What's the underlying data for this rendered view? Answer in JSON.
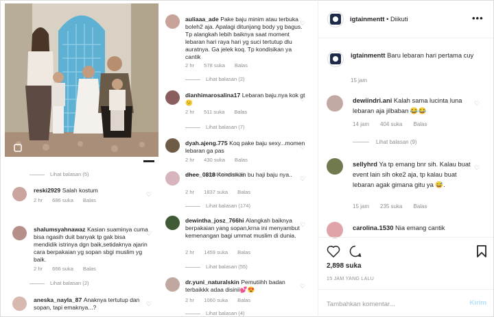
{
  "left": {
    "comments_mid": [
      {
        "user": "auliaaa_ade",
        "text": "Pake baju minim atau terbuka boleh2 aja. Apalagi ditunjang body yg bagus. Tp alangkah lebih baiknya saat moment lebaran hari raya hari yg suci tertutup dlu auratnya. Ga jelek koq. Tp kondisikan ya cantik",
        "time": "2 hr",
        "likes": "578 suka",
        "reply": "Balas",
        "replies": "Lihat balasan (2)"
      },
      {
        "user": "dianhimarosalina17",
        "text": "Lebaran baju.nya kok gt 😕",
        "time": "2 hr",
        "likes": "511 suka",
        "reply": "Balas",
        "replies": "Lihat balasan (7)"
      },
      {
        "user": "dyah.ajeng.775",
        "text": "Koq pake baju sexy...momen lebaran ga pas",
        "time": "2 hr",
        "likes": "430 suka",
        "reply": "Balas",
        "replies": "Lihat balasan (9)"
      },
      {
        "user": "dhee_0818",
        "text": "Kondisikan bu haji baju nya..",
        "time": "2 hr",
        "likes": "1837 suka",
        "reply": "Balas",
        "replies": "Lihat balasan (174)"
      },
      {
        "user": "dewintha_josz_766hi",
        "text": "Alangkah baiknya berpakaian yang sopan,krna ini menyambut kemenangan bagi ummat muslim di dunia.",
        "time": "2 hr",
        "likes": "1459 suka",
        "reply": "Balas",
        "replies": "Lihat balasan (55)"
      },
      {
        "user": "dr.yuni_naturalskin",
        "text": "Pemutiihh badan terbaikkk adaa disinii💕😍",
        "time": "2 hr",
        "likes": "1060 suka",
        "reply": "Balas",
        "replies": "Lihat balasan (4)"
      }
    ],
    "comments_left": [
      {
        "user": "reski2929",
        "text": "Salah kostum",
        "time": "2 hr",
        "likes": "686 suka",
        "reply": "Balas"
      },
      {
        "user": "shalumsyahnawaz",
        "text": "Kasian suaminya cuma bisa ngasih duit banyak tp gak bisa mendidik istrinya dgn baik,setidaknya ajarin cara berpakaian yg sopan sbgi muslim yg baik.",
        "time": "2 hr",
        "likes": "666 suka",
        "reply": "Balas"
      },
      {
        "user": "aneska_nayla_87",
        "text": "Anaknya tertutup dan sopan, tapi emaknya...?",
        "time": "2 hr",
        "likes": "",
        "reply": ""
      }
    ],
    "left_replies": [
      "Lihat balasan (5)",
      "Lihat balasan (2)"
    ]
  },
  "right": {
    "header": {
      "username": "igtainmentt",
      "dot": " • ",
      "follow": "Diikuti",
      "more": "•••"
    },
    "caption": {
      "username": "igtainmentt",
      "text": "Baru lebaran hari pertama cuy",
      "time": "15 jam"
    },
    "comments": [
      {
        "user": "dewiindri.ani",
        "text": "Kalah sama lucinta luna lebaran aja jilbaban 😂😂",
        "time": "14 jam",
        "likes": "404 suka",
        "reply": "Balas",
        "replies": "Lihat balasan (9)"
      },
      {
        "user": "sellyhrd",
        "text": "Ya tp emang bnr sih. Kalau buat event lain sih oke2 aja, tp kalau buat lebaran agak gimana gitu ya 😅.",
        "time": "15 jam",
        "likes": "235 suka",
        "reply": "Balas",
        "replies": ""
      },
      {
        "user": "carolina.1530",
        "text": "Nia emang cantik",
        "time": "",
        "likes": "",
        "reply": "",
        "replies": ""
      }
    ],
    "likes": "2,898 suka",
    "time_ago": "15 JAM YANG LALU",
    "comment_placeholder": "Tambahkan komentar...",
    "send": "Kirim"
  },
  "icons": [
    "heart-icon",
    "comment-icon",
    "bookmark-icon",
    "more-icon"
  ]
}
